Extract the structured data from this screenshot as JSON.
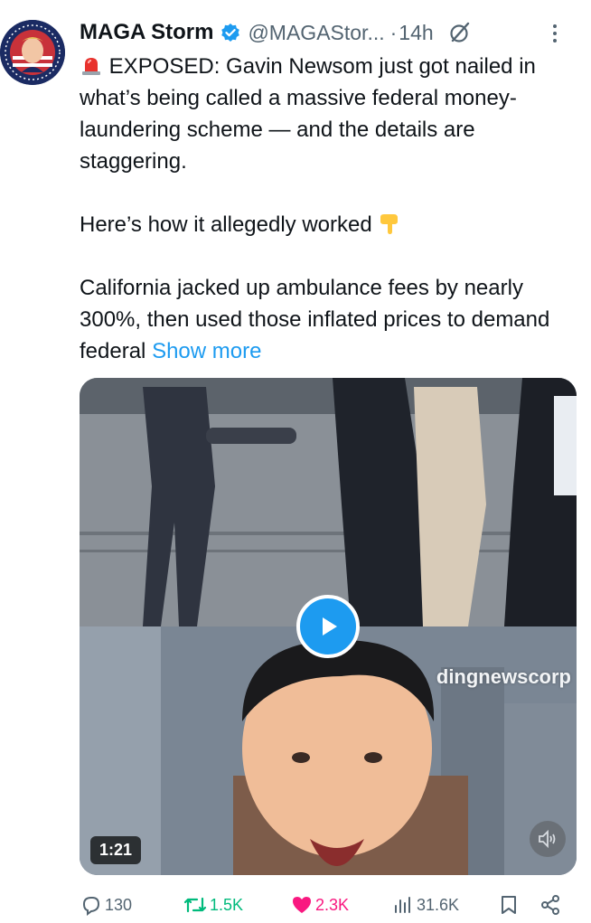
{
  "author": {
    "display_name": "MAGA Storm",
    "handle": "@MAGAStor...",
    "separator": "·",
    "time": "14h",
    "verified_color": "#1d9bf0"
  },
  "tweet": {
    "emoji_prefix": "🚨",
    "paragraphs": [
      "EXPOSED: Gavin Newsom just got nailed in what’s being called a massive federal money-laundering scheme — and the details are staggering.",
      "Here’s how it allegedly worked",
      "California jacked up ambulance fees by nearly 300%, then used those inflated prices to demand federal"
    ],
    "paragraph2_emoji": "👇",
    "show_more": "Show more"
  },
  "media": {
    "watermark": "dingnewscorp",
    "duration": "1:21",
    "play_icon": "play-icon",
    "mute_icon": "speaker-muted-icon"
  },
  "actions": {
    "replies": "130",
    "retweets": "1.5K",
    "likes": "2.3K",
    "views": "31.6K",
    "colors": {
      "retweet": "#00ba7c",
      "like": "#f91880",
      "link": "#1d9bf0"
    }
  }
}
